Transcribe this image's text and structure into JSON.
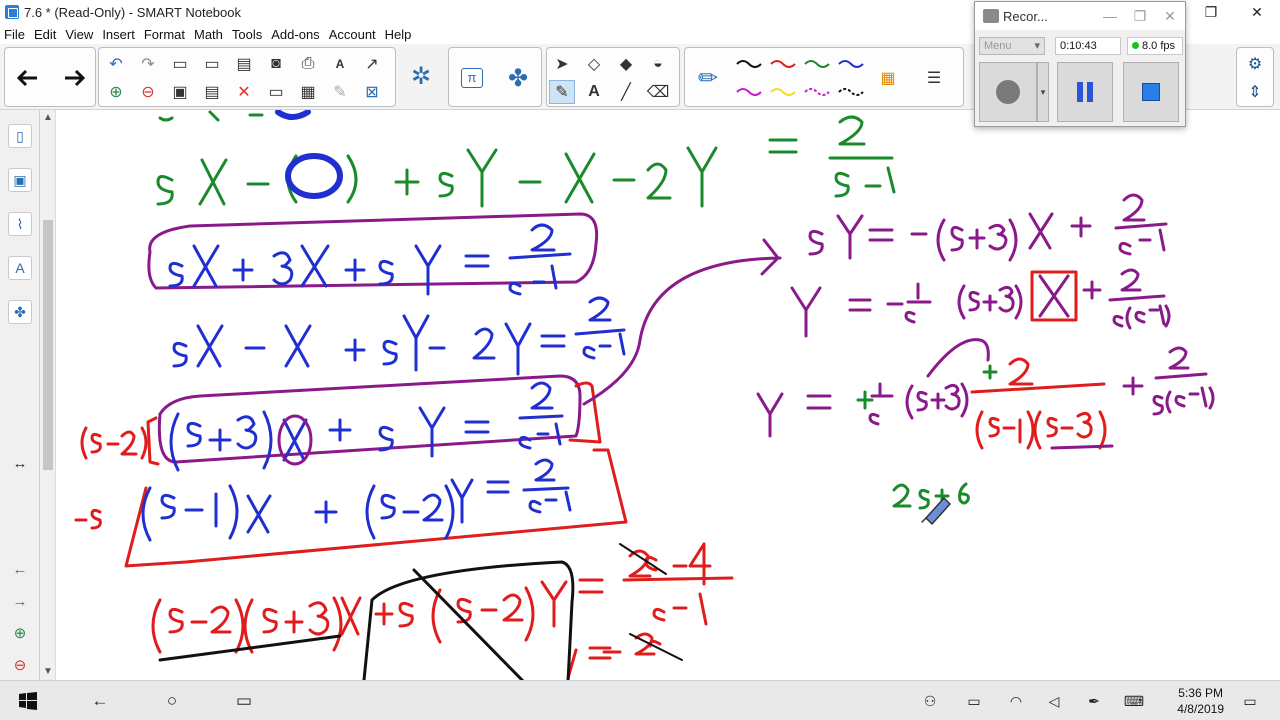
{
  "window": {
    "title": "7.6 * (Read-Only) - SMART Notebook",
    "minimize": "—",
    "restore": "❐",
    "close": "✕"
  },
  "menu": [
    "File",
    "Edit",
    "View",
    "Insert",
    "Format",
    "Math",
    "Tools",
    "Add-ons",
    "Account",
    "Help"
  ],
  "toolbar": {
    "back_icon": "arrow-left-icon",
    "forward_icon": "arrow-right-icon",
    "math_label": "π",
    "text_label": "A",
    "accent_color": "#2a6db0"
  },
  "recorder": {
    "title": "Recor...",
    "menu_label": "Menu",
    "elapsed": "0:10:43",
    "fps": "8.0 fps",
    "record_icon": "record-icon",
    "pause_icon": "pause-icon",
    "stop_icon": "stop-icon"
  },
  "taskbar": {
    "time": "5:36 PM",
    "date": "4/8/2019"
  },
  "ink_colors": {
    "green": "#1a8a2a",
    "blue": "#1f2fd0",
    "purple": "#8a1a8a",
    "red": "#e01c1c",
    "black": "#111111"
  },
  "handwriting": {
    "line1": "sX − (( ) + sY − X − 2Y = 2/(s−1)",
    "line2": "sX + 3X + sY = 2/(s−1)",
    "line3": "sX − X + sY − 2Y = 2/(s−1)",
    "line4": "(s−2) (s+3)X + sY = 2/(s−1)",
    "line5": "−s (s−1)X + (s−2)Y = 2/(s−1)",
    "line6": "(s−2)(s+3)X + s(s−2)Y = (2s−4)/(s−1)",
    "right1": "sY = −(s+3)X + 2/(s−1)",
    "right2": "Y = −1/s (s+3) X + 2/(s(s−1))",
    "right3": "Y = +1/s (s+3) +2/((s−1)(s−3)) + 2/(s(s−1))",
    "right4": "2s+6"
  }
}
